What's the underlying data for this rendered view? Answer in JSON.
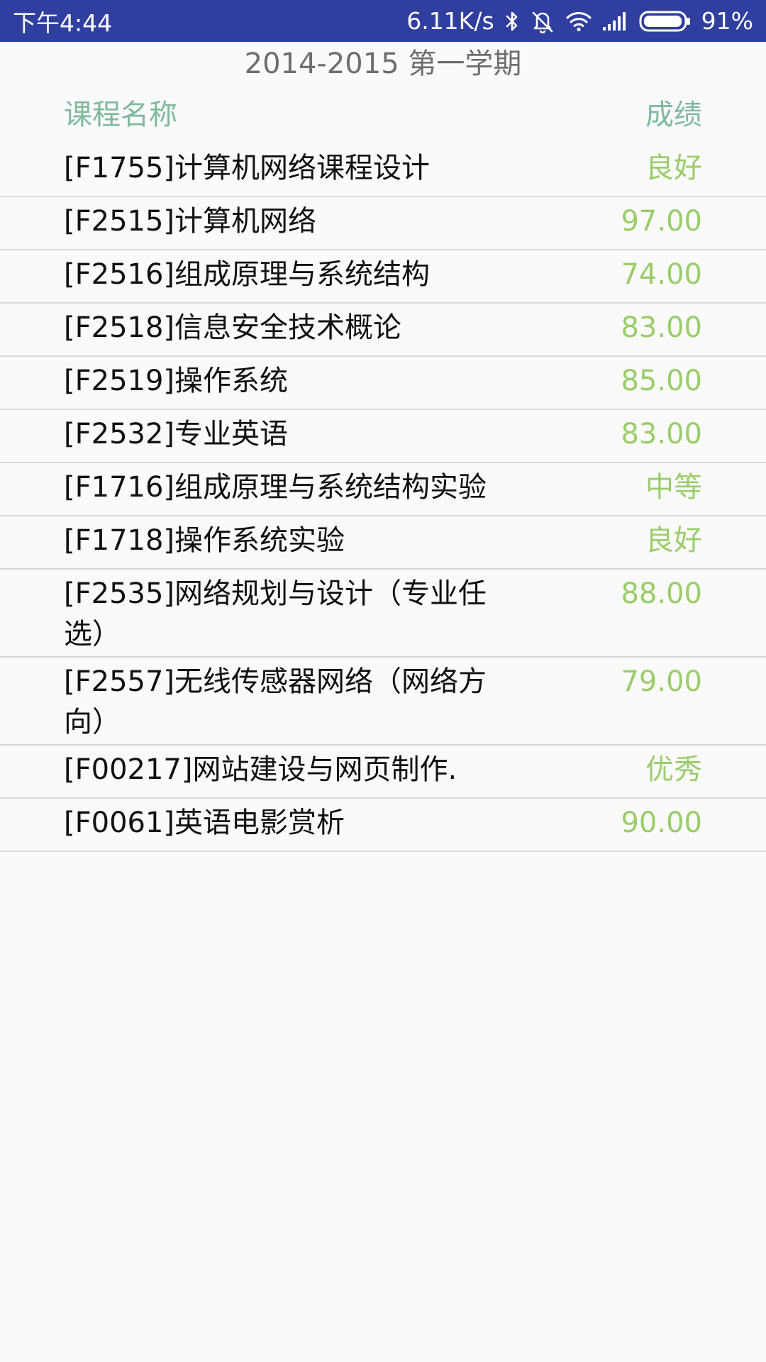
{
  "status_bar": {
    "time": "下午4:44",
    "network_speed": "6.11K/s",
    "battery_percent": "91%",
    "battery_level": 0.91,
    "icons": [
      "bluetooth-icon",
      "mute-vibrate-icon",
      "wifi-icon",
      "signal-icon",
      "battery-icon"
    ],
    "background_color": "#303f9f"
  },
  "semester_title": "2014-2015 第一学期",
  "header": {
    "course_name_label": "课程名称",
    "score_label": "成绩",
    "header_color": "#7fba9e"
  },
  "score_color": "#9acd6a",
  "courses": [
    {
      "name": "[F1755]计算机网络课程设计",
      "score": "良好"
    },
    {
      "name": "[F2515]计算机网络",
      "score": "97.00"
    },
    {
      "name": "[F2516]组成原理与系统结构",
      "score": "74.00"
    },
    {
      "name": "[F2518]信息安全技术概论",
      "score": "83.00"
    },
    {
      "name": "[F2519]操作系统",
      "score": "85.00"
    },
    {
      "name": "[F2532]专业英语",
      "score": "83.00"
    },
    {
      "name": "[F1716]组成原理与系统结构实验",
      "score": "中等"
    },
    {
      "name": "[F1718]操作系统实验",
      "score": "良好"
    },
    {
      "name": "[F2535]网络规划与设计（专业任选）",
      "score": "88.00"
    },
    {
      "name": "[F2557]无线传感器网络（网络方向）",
      "score": "79.00"
    },
    {
      "name": "[F00217]网站建设与网页制作.",
      "score": "优秀"
    },
    {
      "name": "[F0061]英语电影赏析",
      "score": "90.00"
    }
  ]
}
